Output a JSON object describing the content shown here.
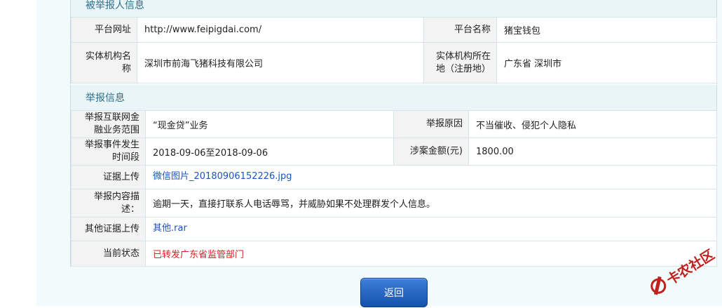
{
  "reported": {
    "section_title": "被举报人信息",
    "platform_url_label": "平台网址",
    "platform_url": "http://www.feipigdai.com/",
    "platform_name_label": "平台名称",
    "platform_name": "猪宝钱包",
    "entity_name_label": "实体机构名称",
    "entity_name": "深圳市前海飞猪科技有限公司",
    "entity_location_label": "实体机构所在地（注册地）",
    "entity_location": "广东省 深圳市"
  },
  "report": {
    "section_title": "举报信息",
    "scope_label": "举报互联网金融业务范围",
    "scope_value": "“现金贷”业务",
    "reason_label": "举报原因",
    "reason_value": "不当催收、侵犯个人隐私",
    "time_label": "举报事件发生时间段",
    "time_value": "2018-09-06至2018-09-06",
    "amount_label": "涉案金额(元)",
    "amount_value": "1800.00",
    "evidence_label": "证据上传",
    "evidence_file": "微信图片_20180906152226.jpg",
    "desc_label": "举报内容描述：",
    "desc_value": "逾期一天，直接打联系人电话辱骂，并威胁如果不处理群发个人信息。",
    "other_evidence_label": "其他证据上传",
    "other_evidence_file": "其他.rar",
    "status_label": "当前状态",
    "status_value": "已转发广东省监管部门"
  },
  "actions": {
    "back_label": "返回"
  },
  "watermark": {
    "text": "卡农社区",
    "icon": "kanong-logo-icon"
  }
}
